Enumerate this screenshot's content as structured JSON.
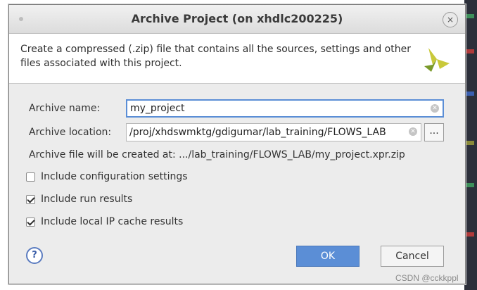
{
  "window": {
    "title": "Archive Project (on xhdlc200225)",
    "close_glyph": "×"
  },
  "header": {
    "description": "Create a compressed (.zip) file that contains all the sources, settings and other files associated with this project.",
    "logo_icon": "vivado-logo-icon"
  },
  "form": {
    "archive_name_label": "Archive name:",
    "archive_name_value": "my_project",
    "archive_location_label": "Archive location:",
    "archive_location_value": "/proj/xhdswmktg/gdigumar/lab_training/FLOWS_LAB",
    "browse_label": "...",
    "created_at_text": "Archive file will be created at: .../lab_training/FLOWS_LAB/my_project.xpr.zip"
  },
  "options": [
    {
      "label": "Include configuration settings",
      "checked": false
    },
    {
      "label": "Include run results",
      "checked": true
    },
    {
      "label": "Include local IP cache results",
      "checked": true
    }
  ],
  "buttons": {
    "help_glyph": "?",
    "ok_label": "OK",
    "cancel_label": "Cancel"
  },
  "watermark": "CSDN @cckkppl",
  "colors": {
    "accent": "#5b8ed6",
    "logo_yellow": "#c9c93a",
    "logo_green": "#7a9a2a"
  }
}
